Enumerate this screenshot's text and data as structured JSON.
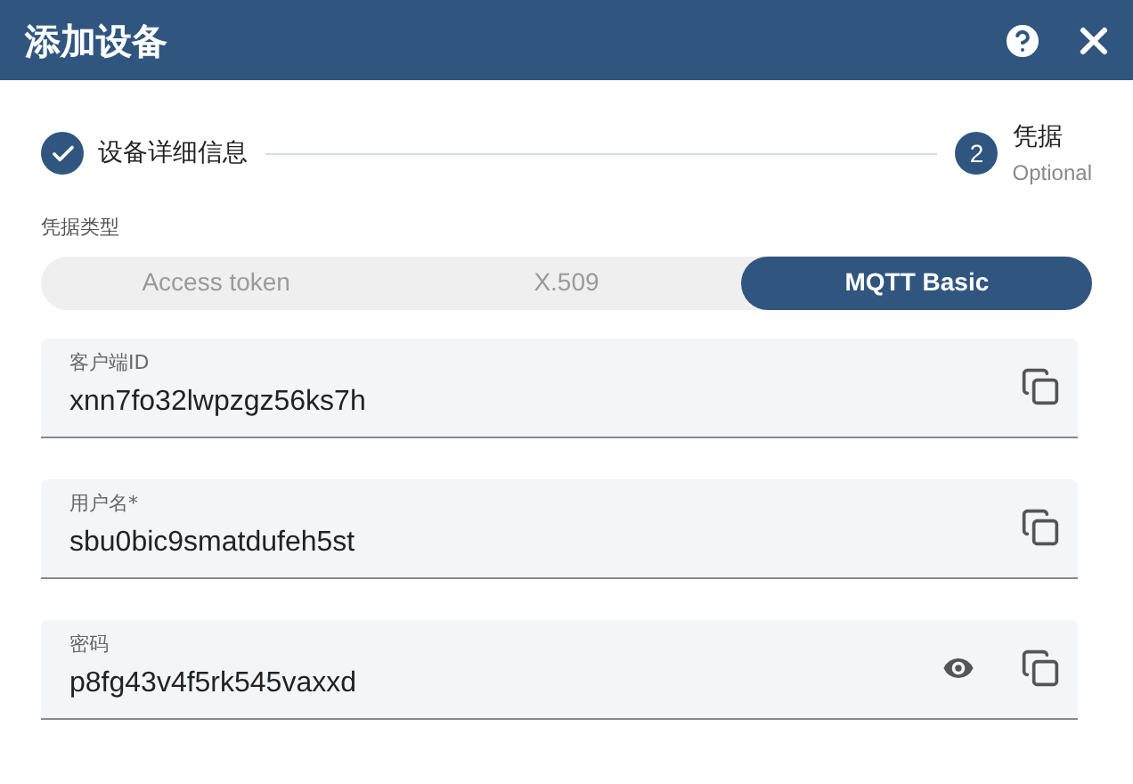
{
  "dialog": {
    "title": "添加设备"
  },
  "steps": [
    {
      "label": "设备详细信息",
      "completed": true
    },
    {
      "number": "2",
      "label": "凭据",
      "completed": false,
      "optional_note": "Optional"
    }
  ],
  "credential_type": {
    "label": "凭据类型",
    "options": [
      {
        "label": "Access token",
        "selected": false
      },
      {
        "label": "X.509",
        "selected": false
      },
      {
        "label": "MQTT Basic",
        "selected": true
      }
    ]
  },
  "fields": [
    {
      "label": "客户端ID",
      "value": "xnn7fo32lwpzgz56ks7h",
      "kind": "text"
    },
    {
      "label": "用户名*",
      "value": "sbu0bic9smatdufeh5st",
      "kind": "text"
    },
    {
      "label": "密码",
      "value": "p8fg43v4f5rk545vaxxd",
      "kind": "password"
    }
  ]
}
